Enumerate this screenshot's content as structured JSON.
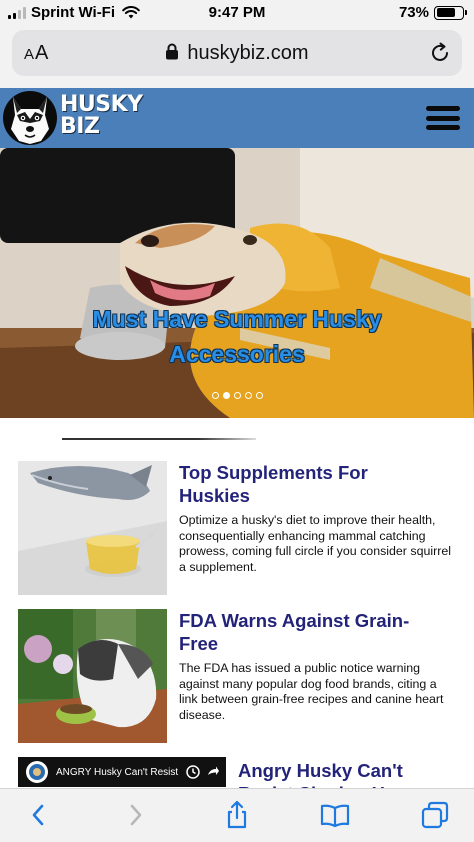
{
  "status_bar": {
    "carrier": "Sprint Wi-Fi",
    "time": "9:47 PM",
    "battery_percent": "73%",
    "battery_level": 0.73,
    "signal_bars": 2,
    "icons": [
      "signal-icon",
      "wifi-icon",
      "battery-icon"
    ]
  },
  "browser": {
    "reader_label_big": "A",
    "reader_label_small": "A",
    "domain": "huskybiz.com",
    "icons": [
      "lock-icon",
      "reload-icon"
    ]
  },
  "site": {
    "logo_line1": "HUSKY",
    "logo_line2": "BIZ",
    "brand_color": "#4a7fb9",
    "menu_icon": "hamburger-menu-icon"
  },
  "hero": {
    "title_line1": "Must Have Summer Husky",
    "title_line2": "Accessories",
    "title_color": "#2a8ee6",
    "slide_count": 5,
    "active_slide": 2
  },
  "articles": [
    {
      "title": "Top Supplements For Huskies",
      "description": "Optimize a husky's diet to improve their health, consequentially enhancing mammal catching prowess, coming full circle if you consider squirrel a supplement."
    },
    {
      "title": "FDA Warns Against Grain-Free",
      "description": "The FDA has issued a public notice warning against many popular dog food brands, citing a link between grain-free recipes and canine heart disease."
    },
    {
      "title": "Angry Husky Can't Resist Singing Happy...",
      "video_label": "ANGRY Husky Can't Resist"
    }
  ],
  "title_color": "#23237a",
  "toolbar": {
    "icons": [
      "back-arrow-icon",
      "forward-arrow-icon",
      "share-icon",
      "bookmarks-icon",
      "tabs-icon"
    ],
    "accent": "#1f7ae0"
  }
}
